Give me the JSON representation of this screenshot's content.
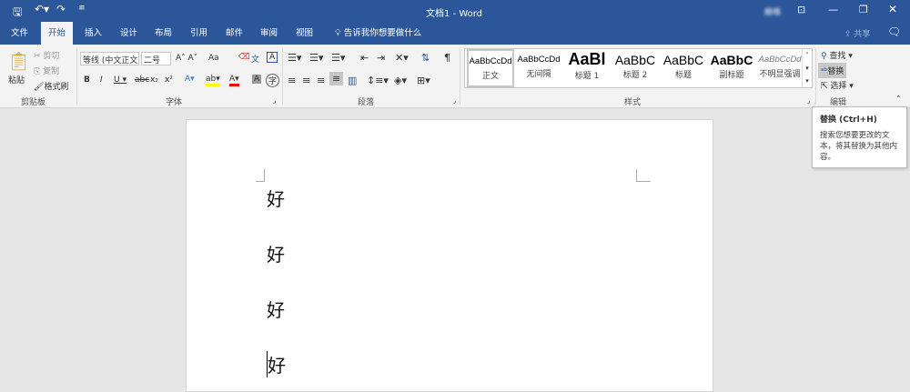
{
  "title": "文档1 - Word",
  "user": "赫格",
  "tabs": [
    "文件",
    "开始",
    "插入",
    "设计",
    "布局",
    "引用",
    "邮件",
    "审阅",
    "视图"
  ],
  "tell_me": "告诉我你想要做什么",
  "share": "共享",
  "clipboard": {
    "paste": "粘贴",
    "cut": "剪切",
    "copy": "复制",
    "format_painter": "格式刷",
    "label": "剪贴板"
  },
  "font": {
    "name": "等线 (中文正文)",
    "size": "二号",
    "label": "字体",
    "aa": "Aa"
  },
  "paragraph": {
    "label": "段落"
  },
  "styles": {
    "label": "样式",
    "items": [
      {
        "preview": "AaBbCcDd",
        "name": "正文"
      },
      {
        "preview": "AaBbCcDd",
        "name": "无间隔"
      },
      {
        "preview": "AaBl",
        "name": "标题 1"
      },
      {
        "preview": "AaBbC",
        "name": "标题 2"
      },
      {
        "preview": "AaBbC",
        "name": "标题"
      },
      {
        "preview": "AaBbC",
        "name": "副标题"
      },
      {
        "preview": "AaBbCcDd",
        "name": "不明显强调"
      }
    ]
  },
  "editing": {
    "find": "查找",
    "replace": "替换",
    "select": "选择",
    "label": "编辑"
  },
  "tooltip": {
    "title": "替换 (Ctrl+H)",
    "body": "搜索您想要更改的文本，将其替换为其他内容。"
  },
  "document": {
    "lines": [
      "好",
      "好",
      "好",
      "好"
    ]
  }
}
